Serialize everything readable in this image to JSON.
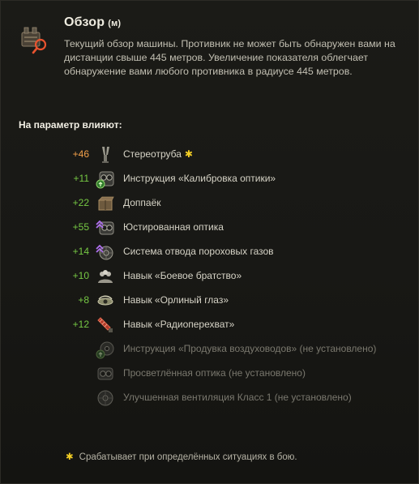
{
  "header": {
    "title": "Обзор",
    "unit": "(м)",
    "icon": "binoculars-search-icon"
  },
  "description": "Текущий обзор машины. Противник не может быть обнаружен вами на дистанции свыше 445 метров. Увеличение показателя облегчает обнаружение вами любого противника в радиусе 445 метров.",
  "influence_label": "На параметр влияют:",
  "items": [
    {
      "value": "+46",
      "label": "Стереотруба",
      "starred": true,
      "icon": "stereo-tube-icon"
    },
    {
      "value": "+11",
      "label": "Инструкция «Калибровка оптики»",
      "icon": "instruction-optics-icon"
    },
    {
      "value": "+22",
      "label": "Доппаёк",
      "icon": "ration-box-icon"
    },
    {
      "value": "+55",
      "label": "Юстированная оптика",
      "icon": "coated-optics-icon"
    },
    {
      "value": "+14",
      "label": "Система отвода пороховых газов",
      "icon": "exhaust-system-icon"
    },
    {
      "value": "+10",
      "label": "Навык «Боевое братство»",
      "icon": "brotherhood-skill-icon"
    },
    {
      "value": "+8",
      "label": "Навык «Орлиный глаз»",
      "icon": "eagle-eye-skill-icon"
    },
    {
      "value": "+12",
      "label": "Навык «Радиоперехват»",
      "icon": "radio-intercept-skill-icon"
    },
    {
      "value": "",
      "label": "Инструкция «Продувка воздуховодов» (не установлено)",
      "icon": "instruction-airflow-icon"
    },
    {
      "value": "",
      "label": "Просветлённая оптика (не установлено)",
      "icon": "clear-optics-icon"
    },
    {
      "value": "",
      "label": "Улучшенная вентиляция Класс 1 (не установлено)",
      "icon": "ventilation-icon"
    }
  ],
  "footnote": "Срабатывает при определённых ситуациях в бою.",
  "colors": {
    "positive": "#76c844",
    "highlight": "#f2a04a",
    "star": "#f4cf25",
    "inactive": "#7a786e"
  }
}
